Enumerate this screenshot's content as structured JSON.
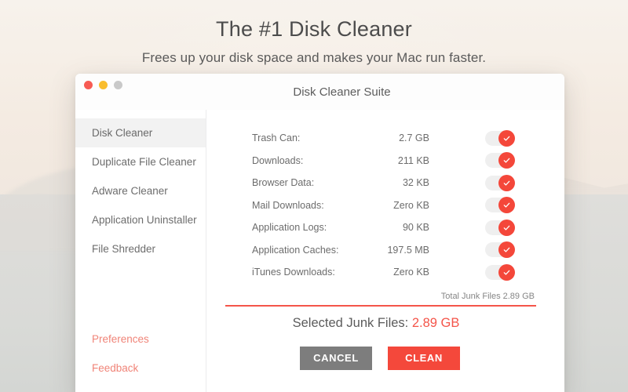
{
  "marketing": {
    "headline": "The #1 Disk Cleaner",
    "subheadline": "Frees up your disk space and makes your Mac run faster."
  },
  "window": {
    "title": "Disk Cleaner Suite",
    "traffic_lights": {
      "close": "close-button",
      "minimize": "minimize-button",
      "zoom": "zoom-button"
    }
  },
  "sidebar": {
    "items": [
      {
        "label": "Disk Cleaner",
        "selected": true
      },
      {
        "label": "Duplicate File Cleaner",
        "selected": false
      },
      {
        "label": "Adware Cleaner",
        "selected": false
      },
      {
        "label": "Application Uninstaller",
        "selected": false
      },
      {
        "label": "File Shredder",
        "selected": false
      }
    ],
    "links": [
      {
        "label": "Preferences"
      },
      {
        "label": "Feedback"
      }
    ]
  },
  "main": {
    "junk_items": [
      {
        "label": "Trash Can:",
        "size": "2.7 GB",
        "enabled": true
      },
      {
        "label": "Downloads:",
        "size": "211 KB",
        "enabled": true
      },
      {
        "label": "Browser Data:",
        "size": "32 KB",
        "enabled": true
      },
      {
        "label": "Mail Downloads:",
        "size": "Zero KB",
        "enabled": true
      },
      {
        "label": "Application Logs:",
        "size": "90 KB",
        "enabled": true
      },
      {
        "label": "Application Caches:",
        "size": "197.5 MB",
        "enabled": true
      },
      {
        "label": "iTunes Downloads:",
        "size": "Zero KB",
        "enabled": true
      }
    ],
    "total_junk_label": "Total Junk Files 2.89 GB",
    "selected_label": "Selected Junk Files:",
    "selected_amount": "2.89 GB",
    "buttons": {
      "cancel": "CANCEL",
      "clean": "CLEAN"
    }
  },
  "colors": {
    "accent_red": "#f4483b",
    "link_red": "#f08478",
    "cancel_gray": "#7d7d7d",
    "traffic_close": "#f75b53",
    "traffic_min": "#f9bd2e",
    "traffic_zoom": "#c9c9c9"
  }
}
